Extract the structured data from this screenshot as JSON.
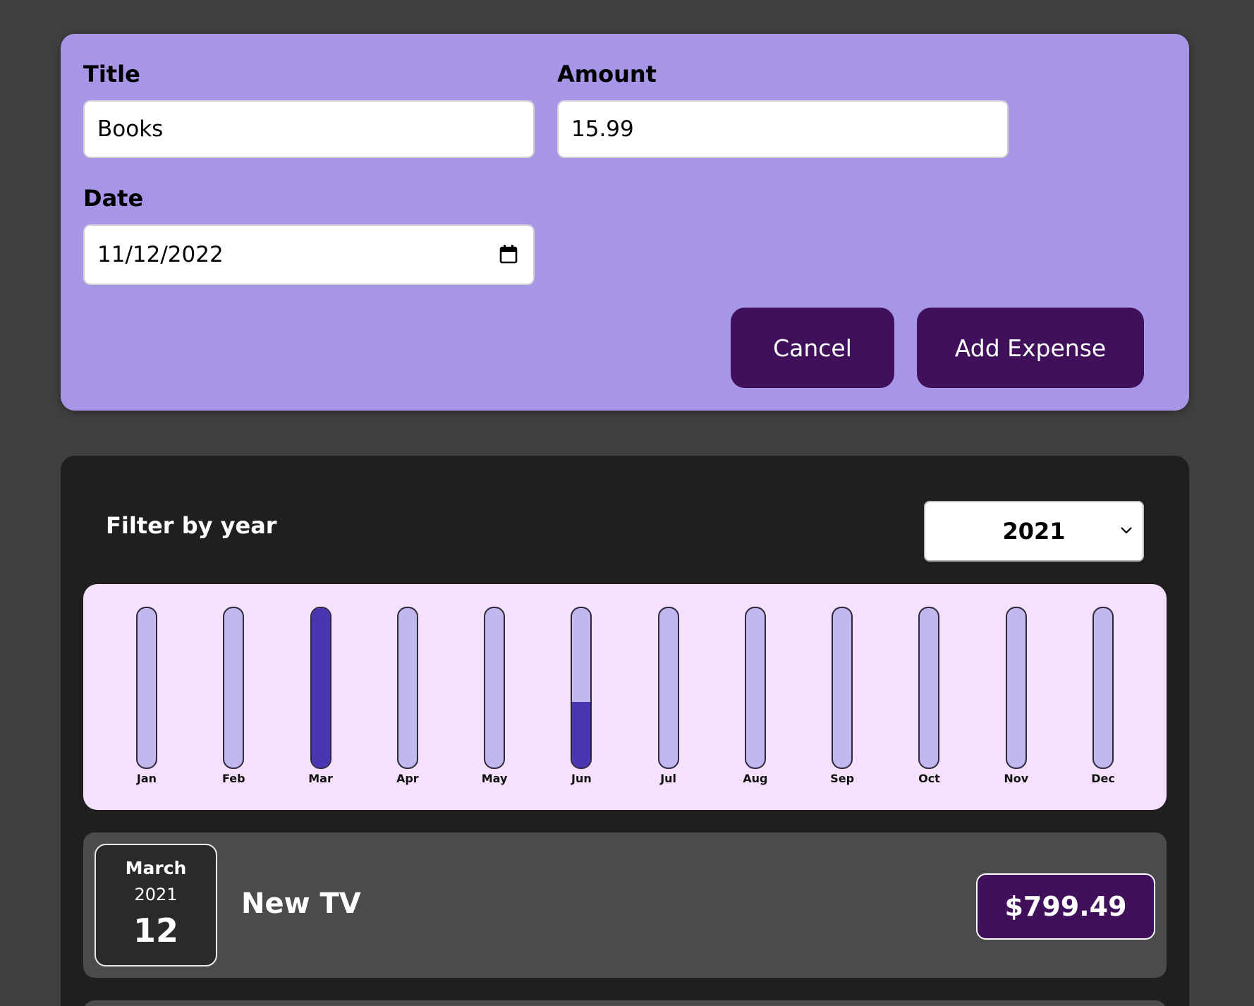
{
  "form": {
    "title_label": "Title",
    "title_value": "Books",
    "amount_label": "Amount",
    "amount_value": "15.99",
    "date_label": "Date",
    "date_value": "11/12/2022",
    "cancel_label": "Cancel",
    "submit_label": "Add Expense",
    "accent_color": "#a796e8",
    "button_color": "#40105a"
  },
  "filter": {
    "label": "Filter by year",
    "selected_year": "2021"
  },
  "chart_data": {
    "type": "bar",
    "categories": [
      "Jan",
      "Feb",
      "Mar",
      "Apr",
      "May",
      "Jun",
      "Jul",
      "Aug",
      "Sep",
      "Oct",
      "Nov",
      "Dec"
    ],
    "values": [
      0,
      0,
      1.0,
      0,
      0,
      0.41,
      0,
      0,
      0,
      0,
      0,
      0
    ],
    "ylim": [
      0,
      1
    ],
    "fill_color": "#4a35b2",
    "track_color": "#c3b7ef",
    "background": "#f7e0fc"
  },
  "expenses": [
    {
      "month": "March",
      "year": "2021",
      "day": "12",
      "title": "New TV",
      "amount": "$799.49"
    }
  ]
}
